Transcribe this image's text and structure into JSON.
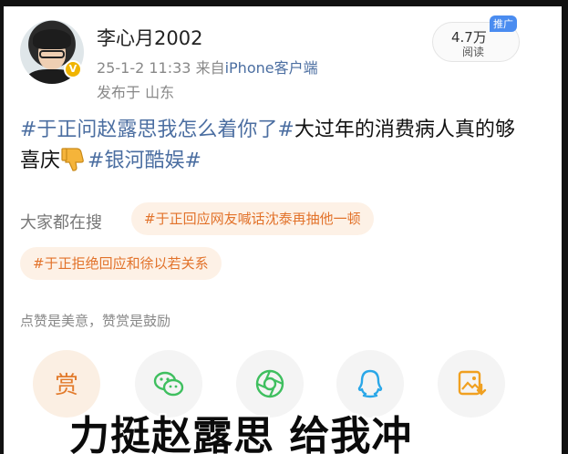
{
  "user": {
    "name": "李心月2002",
    "verified_mark": "V",
    "timestamp": "25-1-2 11:33",
    "source_prefix": "来自",
    "source_app": "iPhone客户端",
    "location": "发布于 山东"
  },
  "promo": {
    "tag": "推广",
    "count": "4.7万",
    "label": "阅读"
  },
  "post": {
    "tag1": "#于正问赵露思我怎么着你了#",
    "text1": "大过年的消费病人真的够喜庆",
    "emoji": "thumbs-down-icon",
    "tag2": "#银河酷娱#"
  },
  "search": {
    "label": "大家都在搜",
    "chips": [
      "#于正回应网友喊话沈泰再抽他一顿",
      "#于正拒绝回应和徐以若关系"
    ]
  },
  "tip": "点赞是美意，赞赏是鼓励",
  "actions": [
    {
      "name": "reward",
      "glyph": "赏",
      "icon": "reward-icon",
      "color": "#e27b2c"
    },
    {
      "name": "wechat",
      "icon": "wechat-icon",
      "color": "#3fbf5f"
    },
    {
      "name": "moments",
      "icon": "moments-icon",
      "color": "#3fbf5f"
    },
    {
      "name": "qq",
      "icon": "qq-icon",
      "color": "#2aa7e8"
    },
    {
      "name": "save-image",
      "icon": "save-image-icon",
      "color": "#f0a020"
    }
  ],
  "caption": "力挺赵露思 给我冲",
  "colors": {
    "link": "#4b6ea1",
    "chip_bg": "#fdf1e6",
    "chip_text": "#e2722a",
    "promo_tag": "#4a8cf0"
  }
}
